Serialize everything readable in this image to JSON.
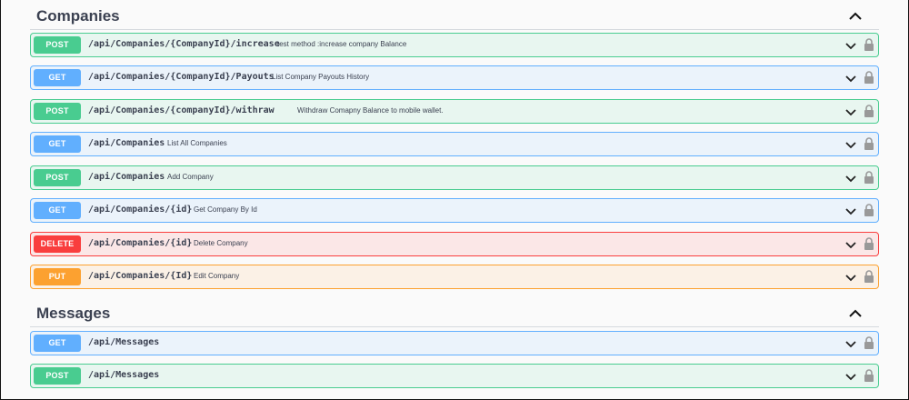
{
  "sections": [
    {
      "title": "Companies",
      "operations": [
        {
          "method": "POST",
          "path": "/api/Companies/{CompanyId}/increase",
          "summary": "test method :increase company Balance"
        },
        {
          "method": "GET",
          "path": "/api/Companies/{CompanyId}/Payouts",
          "summary": "List Company Payouts History"
        },
        {
          "method": "POST",
          "path": "/api/Companies/{companyId}/withraw",
          "summary": "Withdraw Comapny Balance to mobile wallet."
        },
        {
          "method": "GET",
          "path": "/api/Companies",
          "summary": "List All Companies"
        },
        {
          "method": "POST",
          "path": "/api/Companies",
          "summary": "Add Company"
        },
        {
          "method": "GET",
          "path": "/api/Companies/{id}",
          "summary": "Get Company By Id"
        },
        {
          "method": "DELETE",
          "path": "/api/Companies/{id}",
          "summary": "Delete Company"
        },
        {
          "method": "PUT",
          "path": "/api/Companies/{Id}",
          "summary": "Edit Company"
        }
      ]
    },
    {
      "title": "Messages",
      "operations": [
        {
          "method": "GET",
          "path": "/api/Messages",
          "summary": ""
        },
        {
          "method": "POST",
          "path": "/api/Messages",
          "summary": ""
        }
      ]
    }
  ],
  "icons": {
    "expand": "chevron-down-icon",
    "collapse": "chevron-up-icon",
    "auth": "lock-icon"
  },
  "colors": {
    "post": "#49cc90",
    "get": "#61affe",
    "delete": "#f93e3e",
    "put": "#fca130",
    "text": "#3b4151"
  }
}
